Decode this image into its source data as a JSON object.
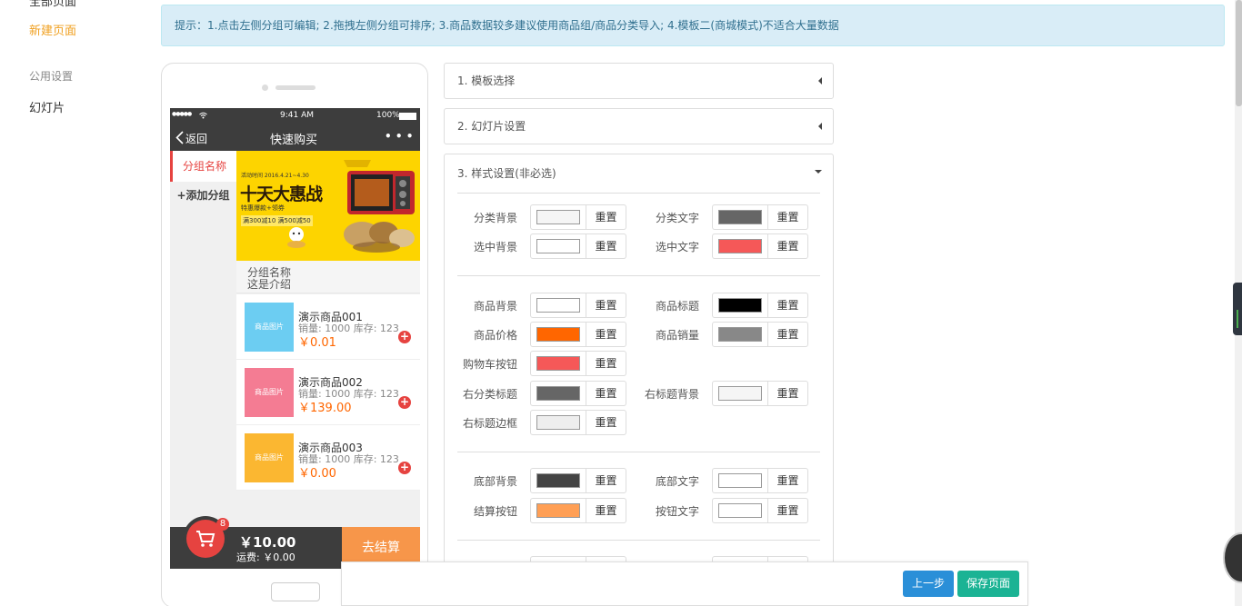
{
  "left_nav": {
    "partial_top": "全部页面",
    "new_page": "新建页面",
    "public_settings": "公用设置",
    "slideshow": "幻灯片"
  },
  "tip": "提示：1.点击左侧分组可编辑; 2.拖拽左侧分组可排序; 3.商品数据较多建议使用商品组/商品分类导入; 4.模板二(商城模式)不适合大量数据",
  "phone": {
    "status": {
      "signal": "●●●●● ",
      "time": "9:41 AM",
      "battery": "100%"
    },
    "nav": {
      "back": "返回",
      "title": "快速购买",
      "more": "• • •"
    },
    "sidebar": {
      "selected": "分组名称",
      "add": "+添加分组"
    },
    "banner": {
      "date": "活动时间 2016.4.21~4.30",
      "headline": "十天大惠战",
      "sub": "特惠爆款+领券",
      "coupon": "满300减10 满500减50"
    },
    "group": {
      "name": "分组名称",
      "intro": "这是介绍"
    },
    "products": [
      {
        "img_text": "商品图片",
        "name": "演示商品001",
        "stat": "销量: 1000 库存: 123",
        "price": "￥0.01",
        "color": "#6ccdf2"
      },
      {
        "img_text": "商品图片",
        "name": "演示商品002",
        "stat": "销量: 1000 库存: 123",
        "price": "￥139.00",
        "color": "#f47c93"
      },
      {
        "img_text": "商品图片",
        "name": "演示商品003",
        "stat": "销量: 1000 库存: 123",
        "price": "￥0.00",
        "color": "#fbb731"
      }
    ],
    "bottom": {
      "badge": "8",
      "total": "￥10.00",
      "freight": "运费: ￥0.00",
      "checkout": "去结算"
    }
  },
  "accordion": {
    "step1": "1. 模板选择",
    "step2": "2. 幻灯片设置",
    "step3": "3. 样式设置(非必选)"
  },
  "style_settings": {
    "reset_label": "重置",
    "rows": [
      {
        "label": "分类背景",
        "color": "#f5f5f5"
      },
      {
        "label": "分类文字",
        "color": "#666666"
      },
      {
        "label": "选中背景",
        "color": "#ffffff"
      },
      {
        "label": "选中文字",
        "color": "#f55858"
      },
      {
        "label": "商品背景",
        "color": "#ffffff"
      },
      {
        "label": "商品标题",
        "color": "#000000"
      },
      {
        "label": "商品价格",
        "color": "#ff6600"
      },
      {
        "label": "商品销量",
        "color": "#888888"
      },
      {
        "label": "购物车按钮",
        "color": "#f55858"
      },
      {
        "label": "右分类标题",
        "color": "#666666"
      },
      {
        "label": "右标题背景",
        "color": "#f5f5f5"
      },
      {
        "label": "右标题边框",
        "color": "#eeeeee"
      },
      {
        "label": "底部背景",
        "color": "#444444"
      },
      {
        "label": "底部文字",
        "color": "#ffffff"
      },
      {
        "label": "结算按钮",
        "color": "#ff9f55"
      },
      {
        "label": "按钮文字",
        "color": "#ffffff"
      }
    ]
  },
  "footer": {
    "prev": "上一步",
    "save": "保存页面",
    "prev_color": "#2a8fd8",
    "save_color": "#1bb394"
  }
}
